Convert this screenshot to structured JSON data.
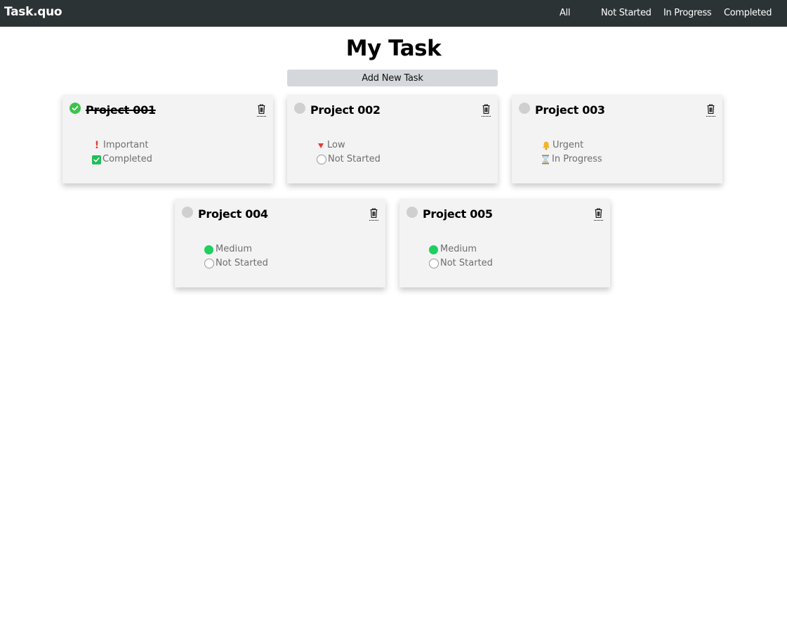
{
  "nav": {
    "brand": "Task.quo",
    "links": [
      "All",
      "Not Started",
      "In Progress",
      "Completed"
    ]
  },
  "page": {
    "title": "My Task",
    "add_button": "Add New Task"
  },
  "tasks": [
    {
      "title": "Project 001",
      "priority": "Important",
      "status": "Completed",
      "done": true
    },
    {
      "title": "Project 002",
      "priority": "Low",
      "status": "Not Started",
      "done": false
    },
    {
      "title": "Project 003",
      "priority": "Urgent",
      "status": "In Progress",
      "done": false
    },
    {
      "title": "Project 004",
      "priority": "Medium",
      "status": "Not Started",
      "done": false
    },
    {
      "title": "Project 005",
      "priority": "Medium",
      "status": "Not Started",
      "done": false
    }
  ],
  "icons": {
    "important": "exclamation-icon",
    "low": "triangle-down-icon",
    "urgent": "bell-icon",
    "medium": "green-circle-icon",
    "completed": "checkbox-checked-icon",
    "not_started": "empty-circle-icon",
    "in_progress": "hourglass-icon",
    "delete": "trash-icon"
  },
  "colors": {
    "navbar": "#2b3334",
    "card": "#f3f3f3",
    "done": "#3bc24a",
    "important": "#e23b3b",
    "medium": "#1fcf5f",
    "urgent": "#f5b324"
  }
}
